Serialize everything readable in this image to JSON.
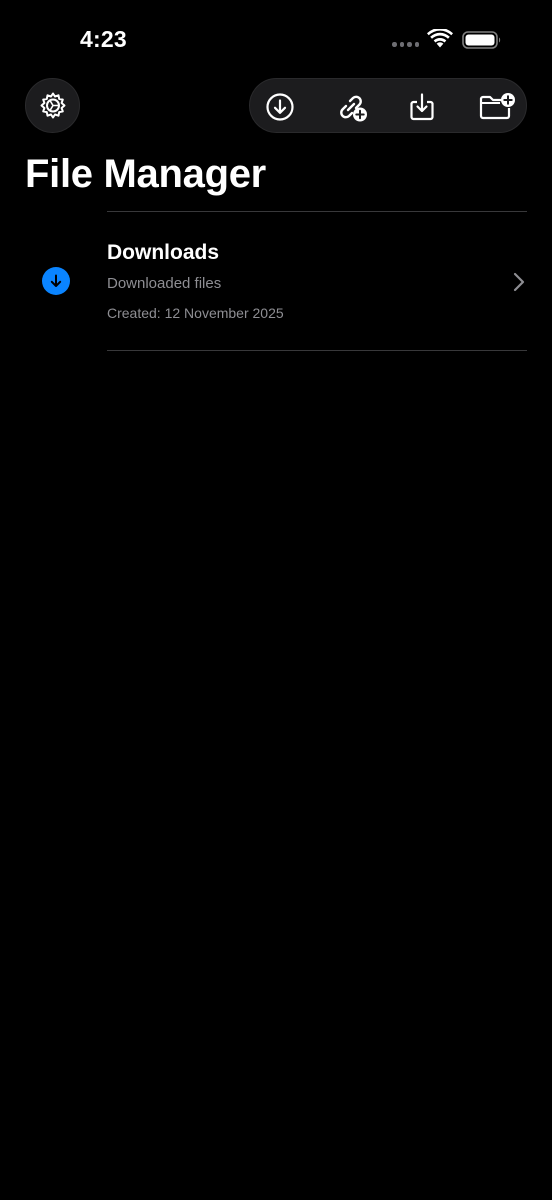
{
  "status_bar": {
    "time": "4:23"
  },
  "toolbar": {
    "settings_icon": "gear-icon",
    "buttons": [
      {
        "icon": "download-circle-icon"
      },
      {
        "icon": "link-add-icon"
      },
      {
        "icon": "import-tray-icon"
      },
      {
        "icon": "folder-add-icon"
      }
    ]
  },
  "page": {
    "title": "File Manager"
  },
  "folders": [
    {
      "title": "Downloads",
      "subtitle": "Downloaded files",
      "created": "Created: 12 November 2025",
      "icon": "download-arrow-icon",
      "icon_color": "#0a84ff"
    }
  ]
}
